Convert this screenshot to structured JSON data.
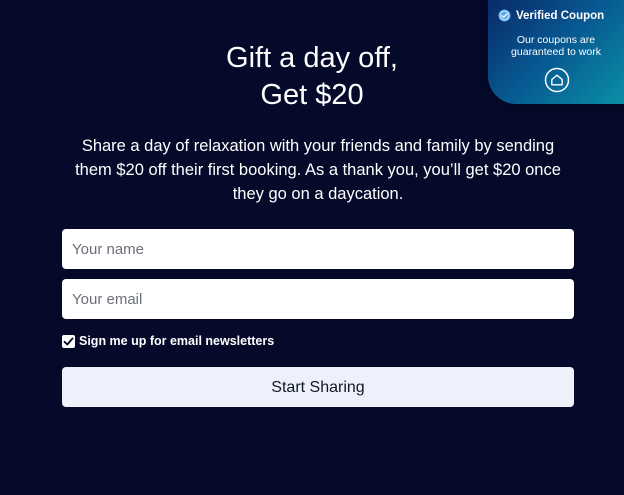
{
  "heading": {
    "line1": "Gift a day off,",
    "line2": "Get $20"
  },
  "description": "Share a day of relaxation with your friends and family by sending them $20 off their first booking. As a thank you, you’ll get $20 once they go on a daycation.",
  "form": {
    "name_placeholder": "Your name",
    "name_value": "",
    "email_placeholder": "Your email",
    "email_value": "",
    "newsletter_label": "Sign me up for email newsletters",
    "newsletter_checked": true,
    "submit_label": "Start Sharing"
  },
  "verified_coupon": {
    "title": "Verified Coupon",
    "subtitle_line1": "Our coupons are",
    "subtitle_line2": "guaranteed to work",
    "check_icon": "check-circle-icon",
    "home_icon": "home-circle-icon"
  },
  "colors": {
    "background": "#050a2a",
    "button_background": "#eef1fb",
    "badge_gradient_start": "#0a2a6a",
    "badge_gradient_end": "#0a8fa6"
  }
}
